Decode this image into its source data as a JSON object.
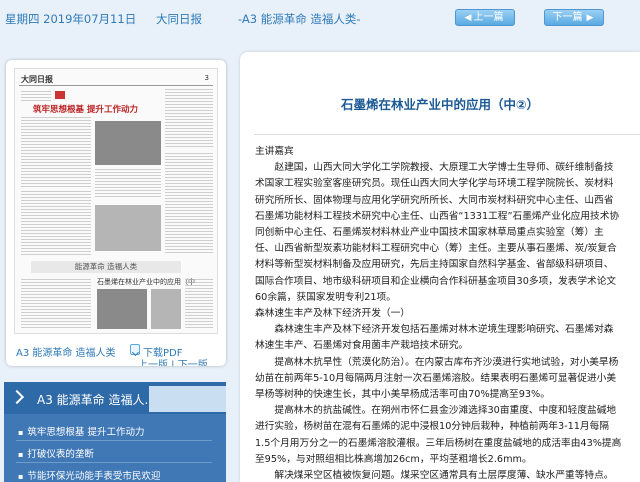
{
  "topbar": {
    "date": "星期四 2019年07月11日",
    "paper": "大同日报",
    "edition": "-A3 能源革命 造福人类-",
    "prev_label": "上一篇",
    "next_label": "下一篇",
    "prev_arrow": "◀",
    "next_arrow": "▶"
  },
  "thumbnail": {
    "masthead": "大同日报",
    "page_no": "3",
    "headline": "筑牢思想根基   提升工作动力",
    "banner": "能源革命 造福人类",
    "subhead": "石墨烯在林业产业中的应用（中"
  },
  "left": {
    "caption": "A3 能源革命 造福人类",
    "download_pdf": "下载PDF",
    "page_links": "上一版 | 下一版"
  },
  "section": {
    "title": "A3  能源革命 造福人...",
    "items": [
      "筑牢思想根基 提升工作动力",
      "打破仪表的垄断",
      "节能环保光动能手表受市民欢迎"
    ]
  },
  "article": {
    "title": "石墨烯在林业产业中的应用（中②）",
    "paragraphs": [
      {
        "indent": false,
        "text": "主讲嘉宾"
      },
      {
        "indent": true,
        "text": "赵建国，山西大同大学化工学院教授、大原理工大学博士生导师、碳纤维制备技术国家工程实验室客座研究员。现任山西大同大学化学与环境工程学院院长、炭材料研究所所长、固体物理与应用化学研究所所长、大同市炭材料研究中心主任、山西省石墨烯功能材料工程技术研究中心主任、山西省“1331工程”石墨烯产业化应用技术协同创新中心主任、石墨烯炭材料林业产业中国技术国家林草局重点实验室（筹）主任、山西省新型炭素功能材料工程研究中心（筹）主任。主要从事石墨烯、炭/炭复合材料等新型炭材料制备及应用研究，先后主持国家自然科学基金、省部级科研项目、国际合作项目、地市级科研项目和企业横向合作科研基金项目30多项，发表学术论文60余篇，获国家发明专利21项。"
      },
      {
        "indent": false,
        "text": "森林速生丰产及林下经济开发（一）"
      },
      {
        "indent": true,
        "text": "森林速生丰产及林下经济开发包括石墨烯对林木逆境生理影响研究、石墨烯对森林速生丰产、石墨烯对食用菌丰产栽培技术研究。"
      },
      {
        "indent": true,
        "text": "提高林木抗旱性（荒漠化防治）。在内蒙古库布齐沙漠进行实地试验，对小美旱杨幼苗在前两年5-10月每隔两月注射一次石墨烯溶胶。结果表明石墨烯可显著促进小美旱杨等树种的快速生长，其中小美旱杨成活率可由70%提高至93%。"
      },
      {
        "indent": true,
        "text": "提高林木的抗盐碱性。在朔州市怀仁县金沙滩选择30亩重度、中度和轻度盐碱地进行实验，杨树苗在混有石墨烯的泥中浸根10分钟后栽种，种植前两年3-11月每隔1.5个月用万分之一的石墨烯溶胶灌根。三年后杨树在重度盐碱地的成活率由43%提高至95%，与对照组相比株高增加26cm，平均茎粗增长2.6mm。"
      },
      {
        "indent": true,
        "text": "解决煤采空区植被恢复问题。煤采空区通常具有土层厚度薄、缺水严重等特点。利"
      }
    ]
  }
}
